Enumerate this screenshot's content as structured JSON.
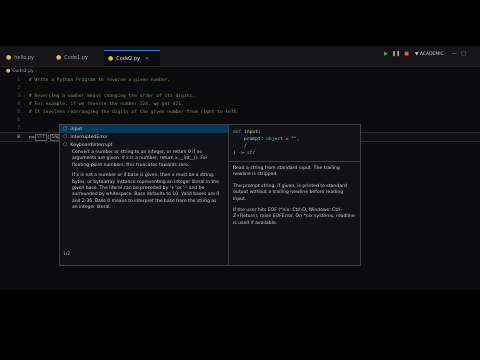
{
  "tabs": [
    {
      "label": "hello.py",
      "active": false
    },
    {
      "label": "Code1.py",
      "active": false
    },
    {
      "label": "Code2.py",
      "active": true
    }
  ],
  "toolbar": {
    "mode_label": "▼ ACADEMIC"
  },
  "breadcrumb": "Code2.py ›",
  "editor": {
    "lines": [
      {
        "num": "1",
        "text": "# Write a Python Program to reverse a given number."
      },
      {
        "num": "2",
        "text": ""
      },
      {
        "num": "3",
        "text": "# Reversing a number means changing the order of its digits."
      },
      {
        "num": "4",
        "text": "# For example, if we reverse the number 124, we get 421."
      },
      {
        "num": "5",
        "text": "# It involves rearranging the digits of the given number from right to left."
      },
      {
        "num": "6",
        "text": ""
      },
      {
        "num": "7",
        "text": ""
      }
    ],
    "current_line": {
      "var": "n",
      "op": "=",
      "fn": "int",
      "paren": "(",
      "typed": "input"
    }
  },
  "suggestions": {
    "items": [
      {
        "kind_icon": "⬡",
        "match": "input",
        "rest": "",
        "selected": true
      },
      {
        "kind_icon": "⬡",
        "match": "I",
        "rest": "nterruptedError",
        "selected": false
      },
      {
        "kind_icon": "⬡",
        "match": "K",
        "rest": "eyboardInterrupt",
        "selected": false
      }
    ],
    "doc_paragraphs": [
      "Convert a number or string to an integer, or return 0 if no arguments are given. If x is a number, return x.__int__(). For floating-point numbers, this truncates towards zero.",
      "If x is not a number or if base is given, then x must be a string, bytes, or bytearray instance representing an integer literal in the given base. The literal can be preceded by '+' or '-' and be surrounded by whitespace. Base defaults to 10. Valid bases are 0 and 2-36. Base 0 means to interpret the base from the string as an integer literal."
    ],
    "counter": "1/2"
  },
  "hover": {
    "signature": {
      "kw": "def",
      "fn": "input",
      "param": "prompt",
      "type": "object",
      "default": "\"\"",
      "ret": "str"
    },
    "doc_paragraphs": [
      "Read a string from standard input. The trailing newline is stripped.",
      "The prompt string, if given, is printed to standard output without a trailing newline before reading input.",
      "If the user hits EOF (*nix: Ctrl-D, Windows: Ctrl-Z+Return), raise EOFError. On *nix systems, readline is used if available."
    ]
  },
  "colors": {
    "accent": "#3a7bd5",
    "comment": "#6a9955",
    "background": "#0b0b0d"
  }
}
